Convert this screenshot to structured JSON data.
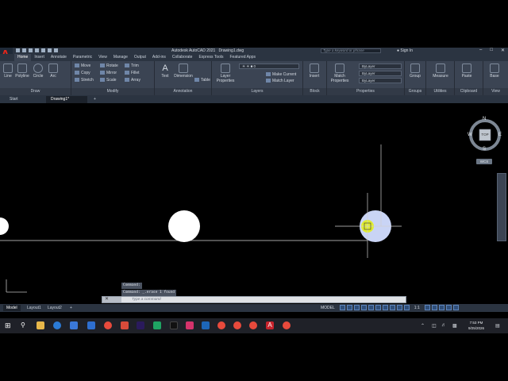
{
  "app": {
    "title": "Autodesk AutoCAD 2021",
    "drawing_name": "Drawing1.dwg",
    "search_placeholder": "Type a keyword or phrase",
    "signin": "Sign In"
  },
  "ribbon_tabs": [
    "Home",
    "Insert",
    "Annotate",
    "Parametric",
    "View",
    "Manage",
    "Output",
    "Add-ins",
    "Collaborate",
    "Express Tools",
    "Featured Apps"
  ],
  "panels": {
    "draw": {
      "title": "Draw",
      "tools": [
        "Line",
        "Polyline",
        "Circle",
        "Arc"
      ]
    },
    "modify": {
      "title": "Modify",
      "tools": [
        "Move",
        "Rotate",
        "Trim",
        "Copy",
        "Mirror",
        "Fillet",
        "Stretch",
        "Scale",
        "Array"
      ]
    },
    "annotation": {
      "title": "Annotation",
      "tools": [
        "Text",
        "Dimension",
        "Table"
      ]
    },
    "layers": {
      "title": "Layers",
      "tools": [
        "Layer Properties",
        "Make Current",
        "Match Layer"
      ]
    },
    "block": {
      "title": "Block",
      "tools": [
        "Insert"
      ]
    },
    "properties": {
      "title": "Properties",
      "match": "Match Properties",
      "bylayer": [
        "ByLayer",
        "ByLayer",
        "ByLayer"
      ]
    },
    "groups": {
      "title": "Groups",
      "tools": [
        "Group"
      ]
    },
    "utilities": {
      "title": "Utilities",
      "tools": [
        "Measure"
      ]
    },
    "clipboard": {
      "title": "Clipboard",
      "tools": [
        "Paste"
      ]
    },
    "view": {
      "title": "View",
      "tools": [
        "Base"
      ]
    }
  },
  "file_tabs": [
    "Start",
    "Drawing1*"
  ],
  "viewcube": {
    "n": "N",
    "s": "S",
    "e": "E",
    "w": "W",
    "top": "TOP",
    "wcs": "WCS"
  },
  "command": {
    "history": [
      "Command:",
      "Command: _.erase 1 found"
    ],
    "placeholder": "Type a command"
  },
  "layout_tabs": [
    "Model",
    "Layout1",
    "Layout2"
  ],
  "status": {
    "model_label": "MODEL",
    "scale": "1:1"
  },
  "clock": {
    "time": "7:53 PM",
    "date": "9/25/2026"
  },
  "colors": {
    "ribbon": "#3b4453",
    "titlebar": "#2b3441",
    "canvas": "#000000",
    "circle": "#ffffff",
    "selected_circle": "#c9d4f5",
    "cursor": "#e3f01a",
    "autocad_red": "#e0271d"
  }
}
